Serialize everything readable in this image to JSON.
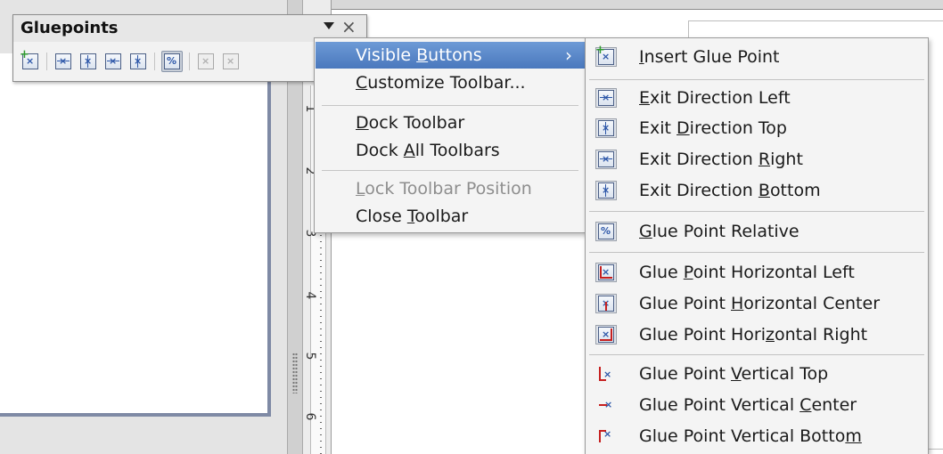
{
  "toolbar": {
    "title": "Gluepoints",
    "buttons": [
      {
        "icon": "insert-glue-point-icon"
      },
      {
        "icon": "exit-direction-left-icon"
      },
      {
        "icon": "exit-direction-top-icon"
      },
      {
        "icon": "exit-direction-right-icon"
      },
      {
        "icon": "exit-direction-bottom-icon"
      },
      {
        "icon": "glue-point-relative-icon",
        "active": true
      },
      {
        "icon": "glue-point-horizontal-left-icon",
        "disabled": true
      },
      {
        "icon": "glue-point-horizontal-center-icon",
        "disabled": true
      }
    ],
    "close_glyph": "×"
  },
  "ruler": {
    "numbers": [
      "1",
      "2",
      "3",
      "4",
      "5",
      "6"
    ]
  },
  "context_menu": {
    "items": [
      {
        "label": "Visible Buttons",
        "mnemonic_prefix": "Visible ",
        "mnemonic": "B",
        "mnemonic_suffix": "uttons",
        "highlight": true,
        "has_submenu": true,
        "arrow": "›"
      },
      {
        "label": "Customize Toolbar...",
        "mnemonic_prefix": "",
        "mnemonic": "C",
        "mnemonic_suffix": "ustomize Toolbar..."
      },
      {
        "label": "Dock Toolbar",
        "mnemonic_prefix": "",
        "mnemonic": "D",
        "mnemonic_suffix": "ock Toolbar"
      },
      {
        "label": "Dock All Toolbars",
        "mnemonic_prefix": "Dock ",
        "mnemonic": "A",
        "mnemonic_suffix": "ll Toolbars"
      },
      {
        "label": "Lock Toolbar Position",
        "mnemonic_prefix": "",
        "mnemonic": "L",
        "mnemonic_suffix": "ock Toolbar Position",
        "disabled": true
      },
      {
        "label": "Close Toolbar",
        "mnemonic_prefix": "Close ",
        "mnemonic": "T",
        "mnemonic_suffix": "oolbar"
      }
    ]
  },
  "submenu": {
    "items": [
      {
        "label": "Insert Glue Point",
        "pre": "",
        "m": "I",
        "post": "nsert Glue Point",
        "icon": "insert-glue-point-icon"
      },
      {
        "label": "Exit Direction Left",
        "pre": "",
        "m": "E",
        "post": "xit Direction Left",
        "icon": "exit-direction-left-icon"
      },
      {
        "label": "Exit Direction Top",
        "pre": "Exit ",
        "m": "D",
        "post": "irection Top",
        "icon": "exit-direction-top-icon"
      },
      {
        "label": "Exit Direction Right",
        "pre": "Exit Direction ",
        "m": "R",
        "post": "ight",
        "icon": "exit-direction-right-icon"
      },
      {
        "label": "Exit Direction Bottom",
        "pre": "Exit Direction ",
        "m": "B",
        "post": "ottom",
        "icon": "exit-direction-bottom-icon"
      },
      {
        "label": "Glue Point Relative",
        "pre": "",
        "m": "G",
        "post": "lue Point Relative",
        "icon": "glue-point-relative-icon"
      },
      {
        "label": "Glue Point Horizontal Left",
        "pre": "Glue ",
        "m": "P",
        "post": "oint Horizontal Left",
        "icon": "glue-point-horizontal-left-icon"
      },
      {
        "label": "Glue Point Horizontal Center",
        "pre": "Glue Point ",
        "m": "H",
        "post": "orizontal Center",
        "icon": "glue-point-horizontal-center-icon"
      },
      {
        "label": "Glue Point Horizontal Right",
        "pre": "Glue Point Hori",
        "m": "z",
        "post": "ontal Right",
        "icon": "glue-point-horizontal-right-icon"
      },
      {
        "label": "Glue Point Vertical Top",
        "pre": "Glue Point ",
        "m": "V",
        "post": "ertical Top",
        "icon": "glue-point-vertical-top-icon"
      },
      {
        "label": "Glue Point Vertical Center",
        "pre": "Glue Point Vertical ",
        "m": "C",
        "post": "enter",
        "icon": "glue-point-vertical-center-icon"
      },
      {
        "label": "Glue Point Vertical Bottom",
        "pre": "Glue Point Vertical Botto",
        "m": "m",
        "post": "",
        "icon": "glue-point-vertical-bottom-icon"
      }
    ]
  },
  "colors": {
    "highlight": "#4a78bd",
    "icon_blue": "#2c56a8",
    "icon_red": "#c62020",
    "icon_green": "#2f9a2f"
  }
}
